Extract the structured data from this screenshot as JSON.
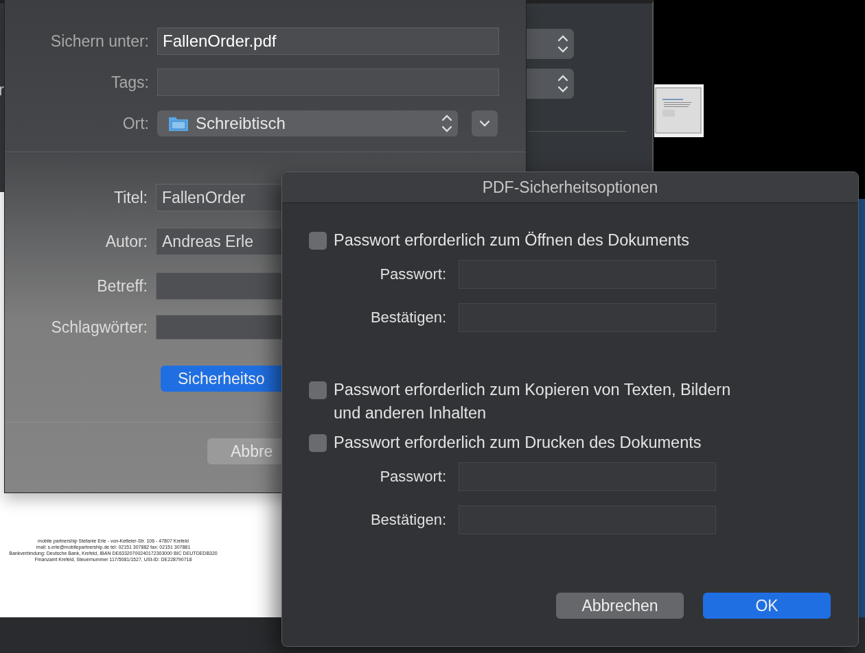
{
  "back_dialog": {
    "label_fragment": "r"
  },
  "document_footer": [
    "mobile partnership Stefanie Erle - von-Ketteler-Str. 106 - 47807 Krefeld",
    "mail: s.erle@mobilepartnership.de   tel: 02151 307882  fax: 02151 307881",
    "Bankverbindung: Deutsche Bank, Krefeld, IBAN DE63320700240172303000 BIC DEUTDEDB320",
    "Finanzamt Krefeld, Steuernummer 117/5081/1527, USt-ID: DE228790718"
  ],
  "save_sheet": {
    "save_as": {
      "label": "Sichern unter:",
      "value": "FallenOrder.pdf"
    },
    "tags": {
      "label": "Tags:"
    },
    "location": {
      "label": "Ort:",
      "value": "Schreibtisch"
    },
    "metadata": [
      {
        "label": "Titel:",
        "value": "FallenOrder"
      },
      {
        "label": "Autor:",
        "value": "Andreas Erle"
      },
      {
        "label": "Betreff:"
      },
      {
        "label": "Schlagwörter:"
      }
    ],
    "security_button": "Sicherheitso",
    "cancel_button": "Abbre"
  },
  "security_dialog": {
    "title": "PDF-Sicherheitsoptionen",
    "options": [
      {
        "kind": "fields",
        "label": "Passwort erforderlich zum Öffnen des Dokuments",
        "checked": false,
        "fields": [
          "Passwort:",
          "Bestätigen:"
        ]
      },
      {
        "kind": "plain",
        "label": "Passwort erforderlich zum Kopieren von Texten, Bildern und anderen Inhalten",
        "checked": false
      },
      {
        "kind": "fields",
        "label": "Passwort erforderlich zum Drucken des Dokuments",
        "checked": false,
        "fields": [
          "Passwort:",
          "Bestätigen:"
        ]
      }
    ],
    "buttons": [
      {
        "label": "Abbrechen",
        "default": false
      },
      {
        "label": "OK",
        "default": true
      }
    ]
  }
}
